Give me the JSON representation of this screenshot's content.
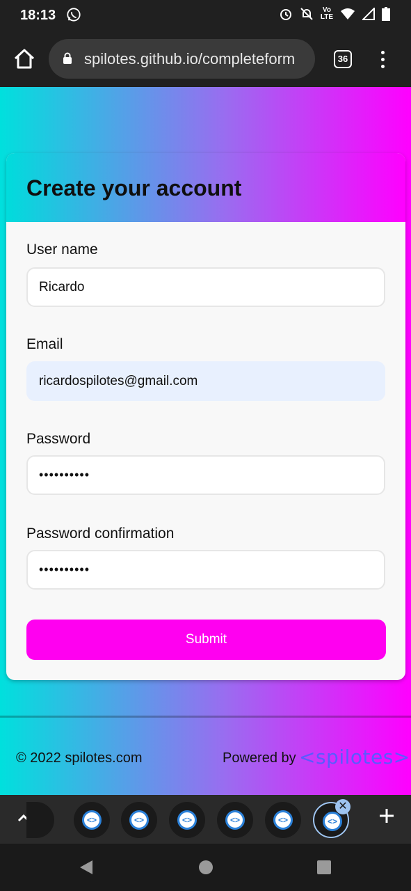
{
  "status_bar": {
    "time": "18:13",
    "icons": [
      "whatsapp-icon",
      "alarm-icon",
      "mute-icon",
      "volte-icon",
      "wifi-icon",
      "signal-icon",
      "battery-icon"
    ],
    "volte_top": "Vo",
    "volte_bottom": "LTE"
  },
  "browser": {
    "url": "spilotes.github.io/completeform",
    "tab_count": "36"
  },
  "form": {
    "title": "Create your account",
    "username_label": "User name",
    "username_value": "Ricardo",
    "email_label": "Email",
    "email_value": "ricardospilotes@gmail.com",
    "password_label": "Password",
    "password_value": "••••••••••",
    "confirm_label": "Password confirmation",
    "confirm_value": "••••••••••",
    "submit_label": "Submit"
  },
  "footer": {
    "copyright": "© 2022 spilotes.com",
    "powered_by": "Powered by",
    "brand": "<spilotes>"
  },
  "tab_strip": {
    "tab_icon_glyph": "<>",
    "close_glyph": "✕"
  },
  "colors": {
    "gradient_start": "#00e0dd",
    "gradient_end": "#ff00ff",
    "submit": "#ff00f0",
    "brand": "#5a5aff"
  }
}
